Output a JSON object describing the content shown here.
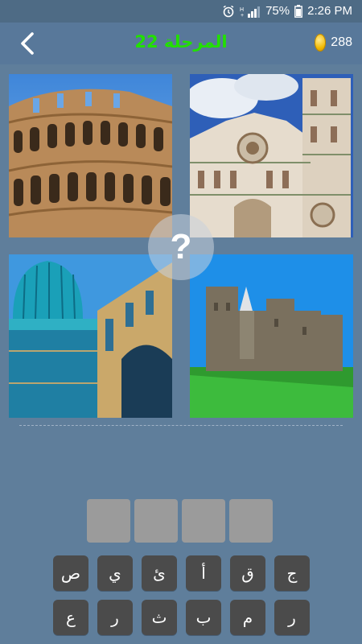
{
  "status_bar": {
    "battery_percent": "75%",
    "time": "2:26 PM",
    "icons": [
      "alarm-icon",
      "signal-icon",
      "battery-icon"
    ]
  },
  "header": {
    "back_icon": "chevron-left-icon",
    "level_label": "المرحلة 22",
    "coins_count": "288",
    "coin_icon": "coin-icon",
    "level_color": "#22e000"
  },
  "puzzle": {
    "images": [
      {
        "subject": "Colosseum"
      },
      {
        "subject": "Florence Cathedral"
      },
      {
        "subject": "Tiled mosque with blue dome"
      },
      {
        "subject": "Stone castle with green lawn"
      }
    ],
    "hint_symbol": "?"
  },
  "answer": {
    "slot_count": 4,
    "slots": [
      "",
      "",
      "",
      ""
    ]
  },
  "keyboard": {
    "row1": [
      "ص",
      "ي",
      "ئ",
      "أ",
      "ق",
      "ج"
    ],
    "row2": [
      "ع",
      "ر",
      "ث",
      "ب",
      "م",
      "ر"
    ]
  }
}
